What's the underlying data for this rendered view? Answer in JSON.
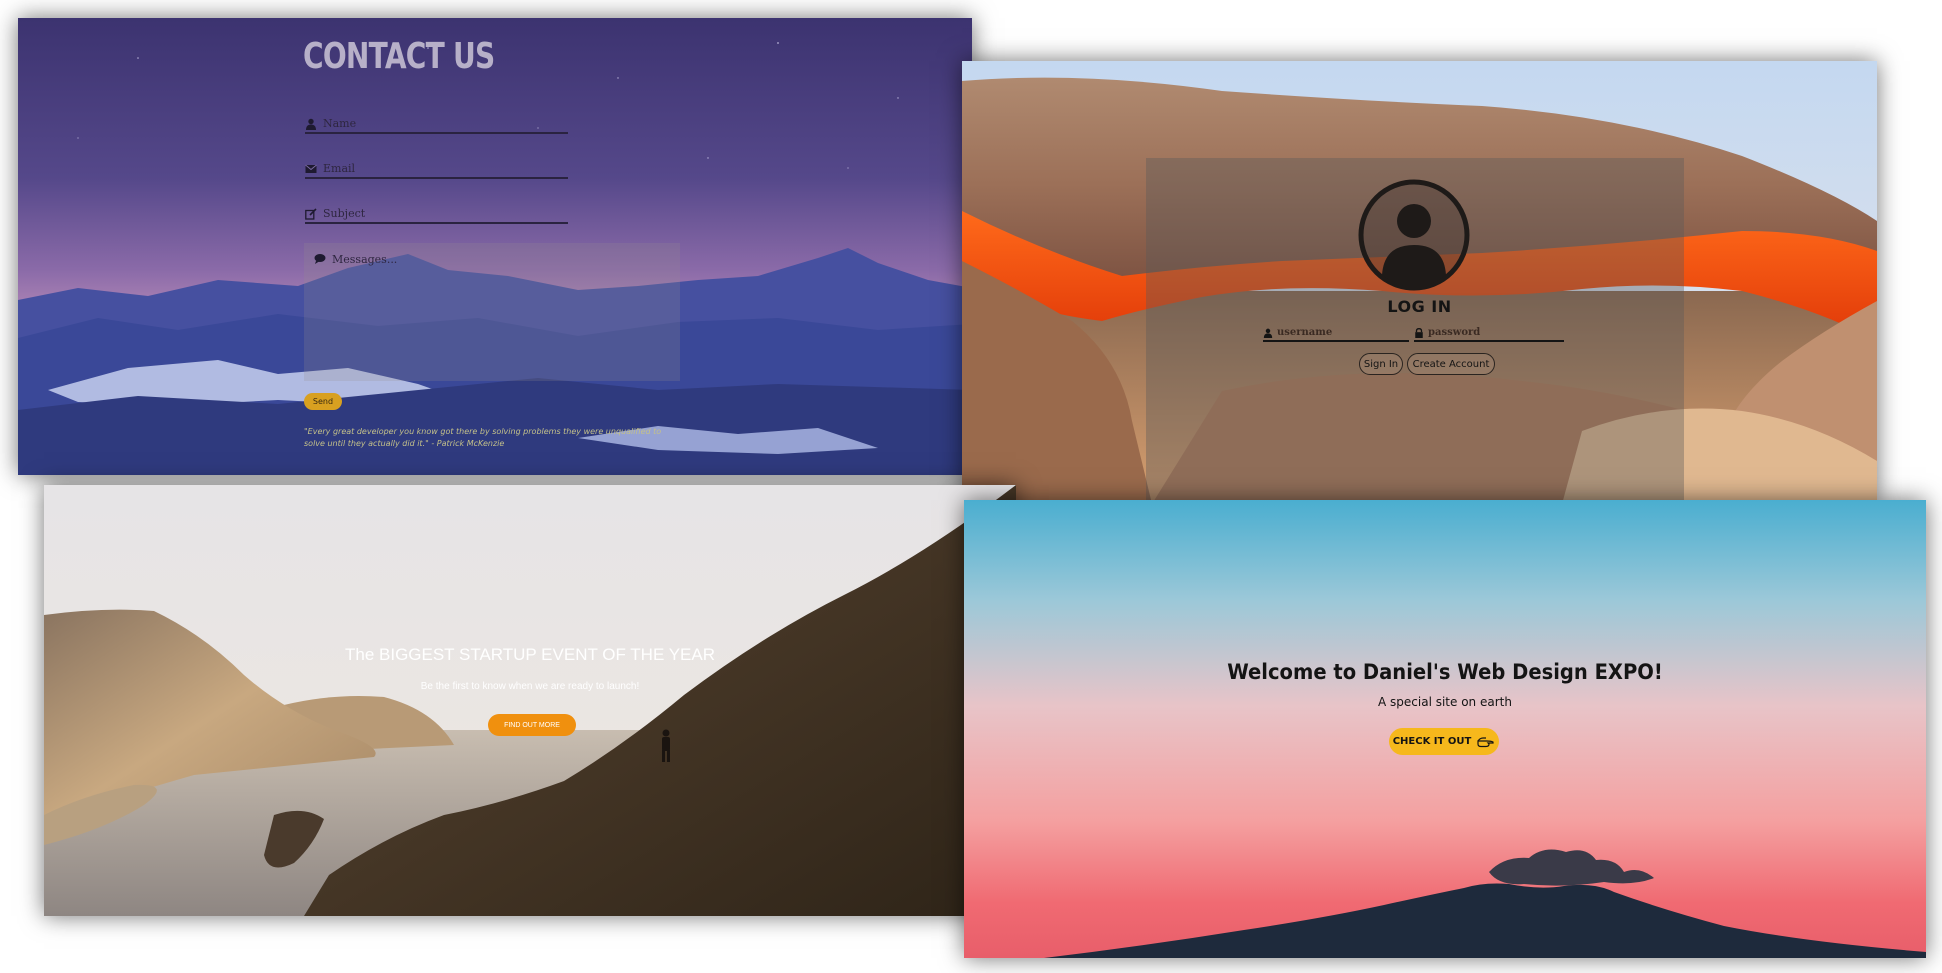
{
  "contact": {
    "title": "CONTACT US",
    "name_placeholder": "Name",
    "email_placeholder": "Email",
    "subject_placeholder": "Subject",
    "message_placeholder": "Messages...",
    "send_label": "Send",
    "quote": "\"Every great developer you know got there by solving problems they were unqualified to solve until they actually did it.\" - Patrick McKenzie"
  },
  "login": {
    "title": "LOG IN",
    "username_placeholder": "username",
    "password_placeholder": "password",
    "signin_label": "Sign In",
    "create_label": "Create Account"
  },
  "startup": {
    "title": "The BIGGEST STARTUP EVENT OF THE YEAR",
    "subtitle": "Be the first to know when we are ready to launch!",
    "button_label": "FIND OUT MORE"
  },
  "welcome": {
    "title": "Welcome to Daniel's Web Design EXPO!",
    "subtitle": "A special site on earth",
    "button_label": "CHECK IT OUT"
  },
  "colors": {
    "send_button": "#d8a020",
    "find_out_more_button": "#f0900e",
    "check_it_out_button": "#f6b81c"
  },
  "icons": [
    "user-icon",
    "envelope-icon",
    "edit-icon",
    "comment-icon",
    "lock-icon",
    "avatar-icon",
    "hand-point-icon"
  ]
}
